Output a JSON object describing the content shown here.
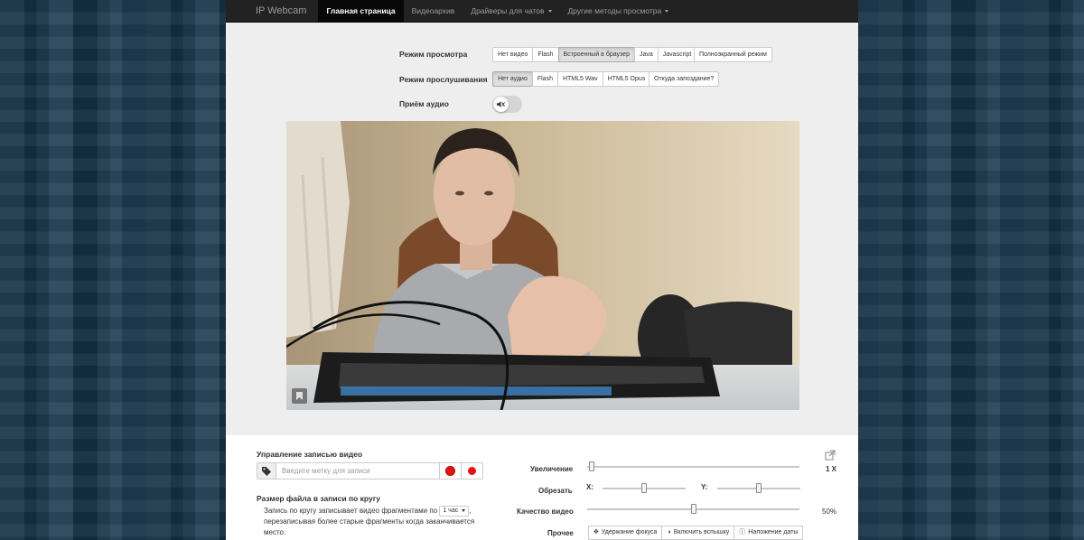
{
  "navbar": {
    "brand": "IP Webcam",
    "items": [
      {
        "label": "Главная страница"
      },
      {
        "label": "Видеоархив"
      },
      {
        "label": "Драйверы для чатов"
      },
      {
        "label": "Другие методы просмотра"
      }
    ]
  },
  "view_mode": {
    "label": "Режим просмотра",
    "options": [
      "Нет видео",
      "Flash",
      "Встроенный в браузер",
      "Java",
      "Javascript"
    ],
    "selected": "Встроенный в браузер",
    "fullscreen": "Полноэкранный режим"
  },
  "listen_mode": {
    "label": "Режим прослушивания",
    "options": [
      "Нет аудио",
      "Flash",
      "HTML5 Wav",
      "HTML5 Opus"
    ],
    "selected": "Нет аудио",
    "latency_help": "Откуда запоздание?"
  },
  "audio_receive": {
    "label": "Приём аудио",
    "enabled": false
  },
  "video_stream": {
    "icon": "bookmark-icon"
  },
  "recording": {
    "title": "Управление записью видео",
    "tag_placeholder": "Введите метку для записи",
    "tag_icon": "tag-icon",
    "loop_title": "Размер файла в записи по кругу",
    "loop_text_1": "Запись по кругу записывает видео фрагментами по",
    "loop_chunk": "1 час",
    "loop_text_2": ", перезаписывая более старые фрагменты когда заканчивается место."
  },
  "controls": {
    "zoom_label": "Увеличение",
    "zoom_value": "1 X",
    "zoom_level": 0.02,
    "crop_label": "Обрезать",
    "crop_x_label": "X:",
    "crop_y_label": "Y:",
    "crop_x": 0.5,
    "crop_y": 0.5,
    "quality_label": "Качество видео",
    "quality_value": "50%",
    "quality_level": 0.5,
    "misc_label": "Прочее",
    "misc_buttons": [
      {
        "label": "Удержание фокуса",
        "icon": "move-icon"
      },
      {
        "label": "Включить вспышку",
        "icon": "half-circle-icon"
      },
      {
        "label": "Наложение даты",
        "icon": "info-icon"
      }
    ]
  }
}
